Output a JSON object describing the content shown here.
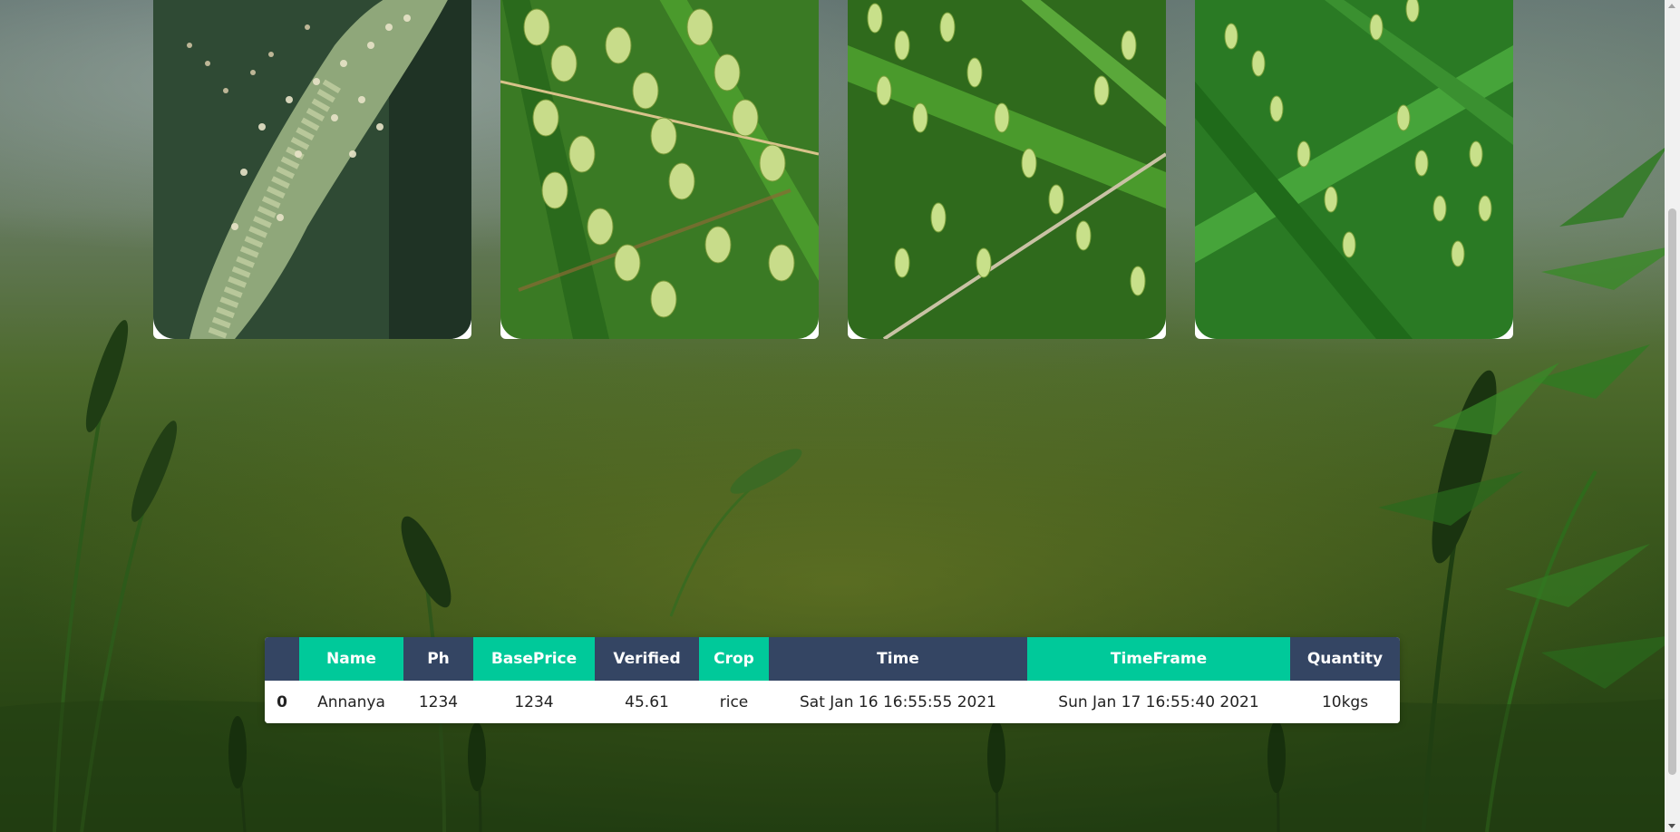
{
  "gallery": {
    "cards": [
      {
        "image": "millet-flower-photo"
      },
      {
        "image": "rice-grain-photo"
      },
      {
        "image": "rice-panicle-photo"
      },
      {
        "image": "rice-plant-photo"
      }
    ]
  },
  "table": {
    "headers": [
      "",
      "Name",
      "Ph",
      "BasePrice",
      "Verified",
      "Crop",
      "Time",
      "TimeFrame",
      "Quantity"
    ],
    "rows": [
      {
        "index": "0",
        "name": "Annanya",
        "ph": "1234",
        "base_price": "1234",
        "verified": "45.61",
        "crop": "rice",
        "time": "Sat Jan 16 16:55:55 2021",
        "time_frame": "Sun Jan 17 16:55:40 2021",
        "quantity": "10kgs"
      }
    ]
  },
  "colors": {
    "header_dark": "#344563",
    "header_green": "#00c99a",
    "row_background": "#ffffff"
  }
}
